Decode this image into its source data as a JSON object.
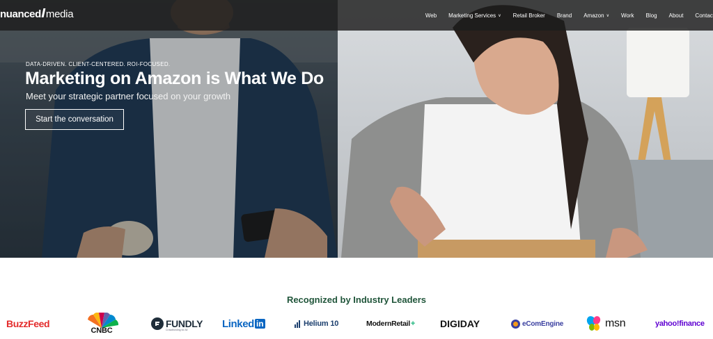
{
  "header": {
    "logo": {
      "part1": "nuanced",
      "part2": "media"
    },
    "nav": [
      {
        "label": "Web",
        "dropdown": false
      },
      {
        "label": "Marketing Services",
        "dropdown": true
      },
      {
        "label": "Retail Broker",
        "dropdown": false
      },
      {
        "label": "Brand",
        "dropdown": false
      },
      {
        "label": "Amazon",
        "dropdown": true
      },
      {
        "label": "Work",
        "dropdown": false
      },
      {
        "label": "Blog",
        "dropdown": false
      },
      {
        "label": "About",
        "dropdown": false
      },
      {
        "label": "Contact",
        "dropdown": false
      }
    ]
  },
  "hero": {
    "eyebrow": "DATA-DRIVEN. CLIENT-CENTERED. ROI-FOCUSED.",
    "headline": "Marketing on Amazon is What We Do",
    "subhead": "Meet your strategic partner focused on your growth",
    "cta": "Start the conversation"
  },
  "recognized": {
    "title": "Recognized by Industry Leaders",
    "logos": {
      "buzzfeed": "BuzzFeed",
      "cnbc": "CNBC",
      "fundly": "FUNDLY",
      "fundly_sub": "Crowdfunding for All",
      "linkedin_a": "Linked",
      "linkedin_b": "in",
      "helium": "Helium 10",
      "modernretail": "ModernRetail",
      "modernretail_plus": "+",
      "digiday": "DIGIDAY",
      "ecomengine": "eComEngine",
      "msn": "msn",
      "yahoo": "yahoo!finance"
    }
  },
  "colors": {
    "heading_green": "#20553a",
    "buzzfeed_red": "#e32b2b",
    "linkedin_blue": "#0a66c2",
    "yahoo_purple": "#5f01d1"
  }
}
